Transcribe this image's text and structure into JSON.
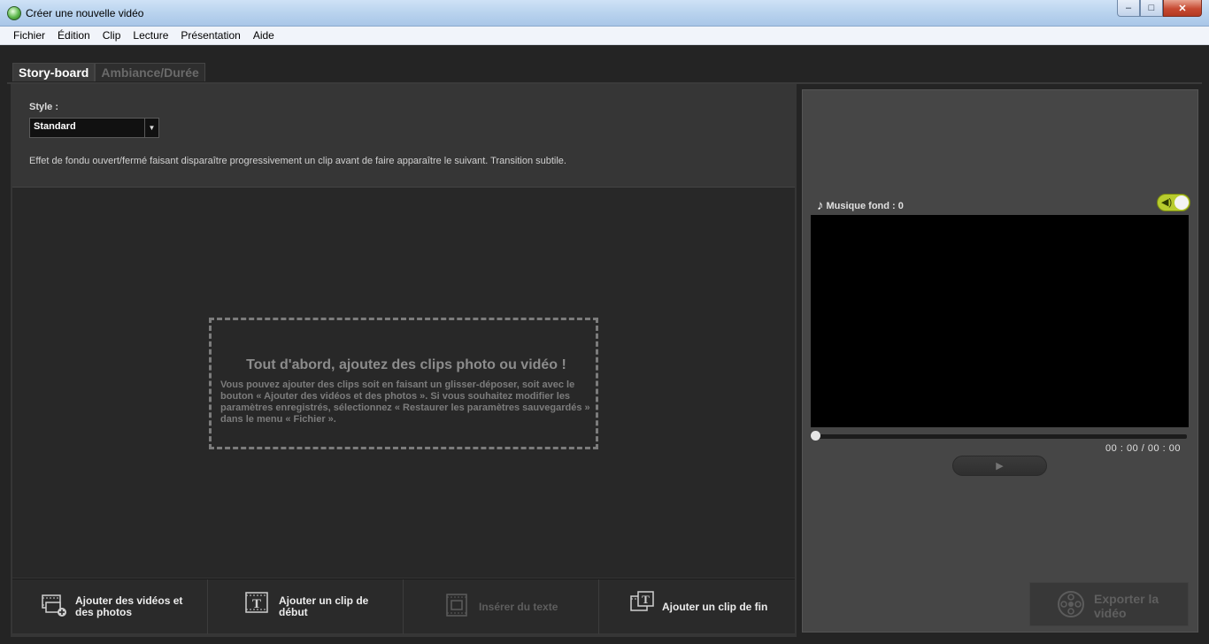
{
  "window": {
    "title": "Créer une nouvelle vidéo",
    "controls": {
      "minimize": "–",
      "maximize": "□",
      "close": "✕"
    }
  },
  "menu": [
    "Fichier",
    "Édition",
    "Clip",
    "Lecture",
    "Présentation",
    "Aide"
  ],
  "tabs": [
    {
      "label": "Story-board",
      "active": true
    },
    {
      "label": "Ambiance/Durée",
      "active": false
    }
  ],
  "style": {
    "label": "Style :",
    "selected": "Standard",
    "arrow": "▼",
    "description": "Effet de fondu ouvert/fermé faisant disparaître progressivement un clip avant de faire apparaître le suivant. Transition subtile."
  },
  "dropzone": {
    "title": "Tout d'abord, ajoutez des clips photo ou vidéo !",
    "text": "Vous pouvez ajouter des clips soit en faisant un glisser-déposer, soit avec le bouton « Ajouter des vidéos et des photos ». Si vous souhaitez modifier les paramètres enregistrés, sélectionnez « Restaurer les paramètres sauvegardés » dans le menu « Fichier »."
  },
  "toolbar": {
    "add_media": "Ajouter des vidéos et des photos",
    "add_start_clip": "Ajouter un clip de début",
    "insert_text": "Insérer du texte",
    "add_end_clip": "Ajouter un clip de fin"
  },
  "player": {
    "music_label": "Musique fond : 0",
    "music_icon": "♪",
    "speaker_icon": "◀)",
    "timecode": "00 : 00 / 00 : 00",
    "play_icon": "▶",
    "progress": 0,
    "music_enabled": true
  },
  "export": {
    "label": "Exporter la vidéo"
  },
  "colors": {
    "background": "#242424",
    "panel": "#363636",
    "toggle_on": "#b8cc2e"
  }
}
